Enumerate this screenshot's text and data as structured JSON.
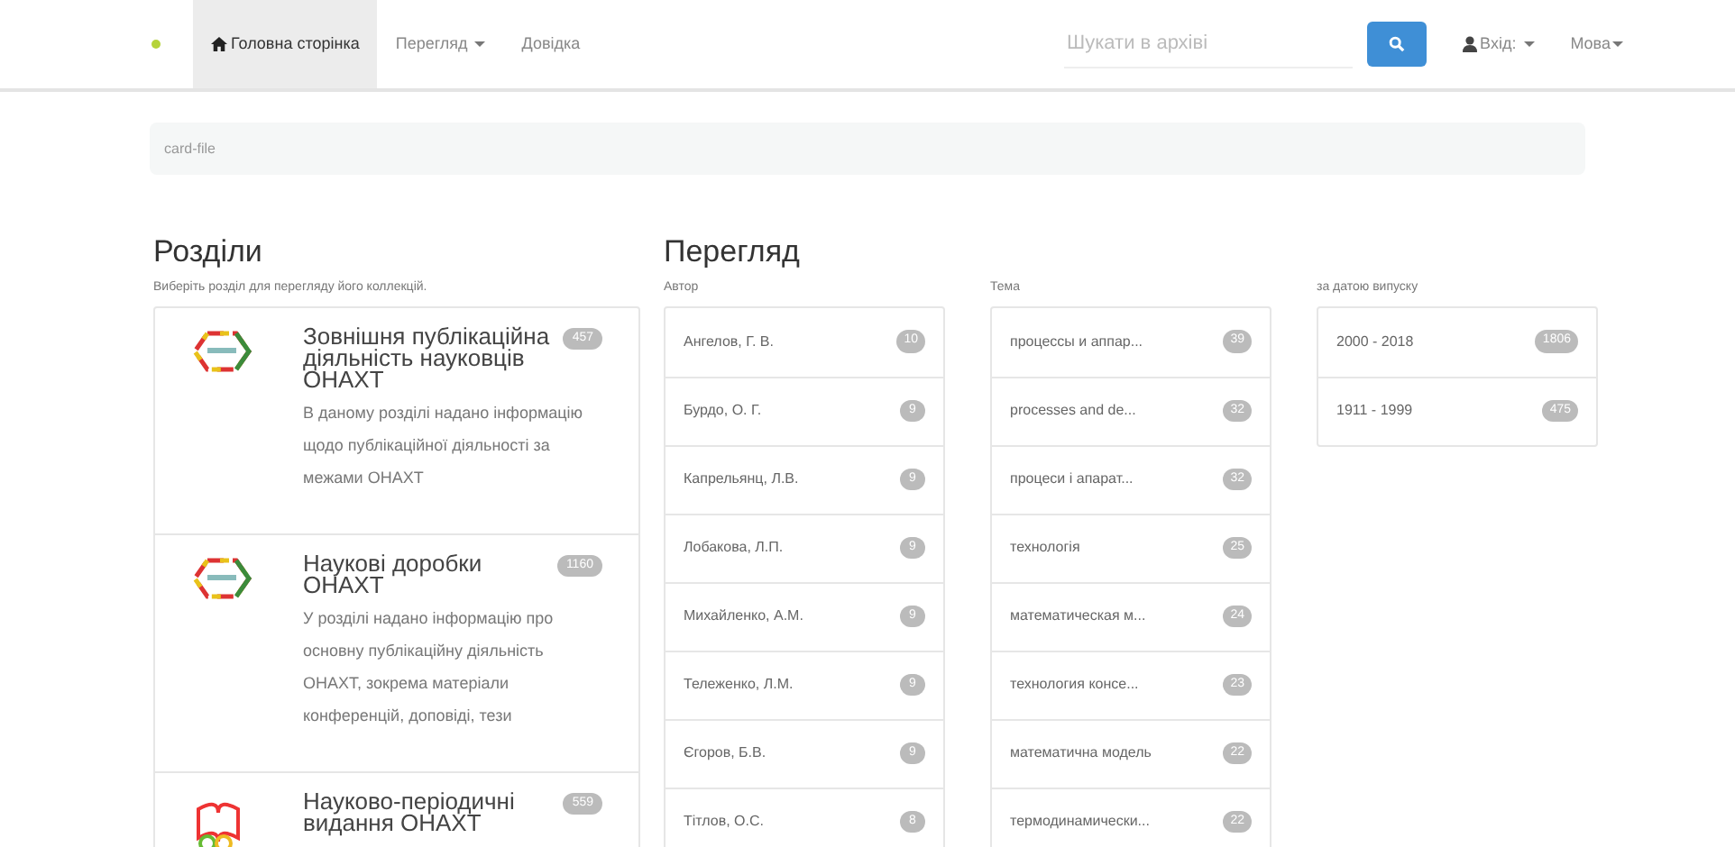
{
  "navbar": {
    "items": [
      {
        "label": "Головна сторінка",
        "selected": true,
        "dropdown": false,
        "kind": "home"
      },
      {
        "label": "Перегляд",
        "selected": false,
        "dropdown": true,
        "kind": "plain"
      },
      {
        "label": "Довідка",
        "selected": false,
        "dropdown": false,
        "kind": "plain"
      }
    ],
    "search": {
      "placeholder": "Шукати в архіві"
    },
    "login": {
      "label": "Вхід:"
    },
    "language": {
      "label": "Мова"
    }
  },
  "breadcrumb": "card-file",
  "sections": {
    "title": "Розділи",
    "hint": "Виберіть розділ для перегляду його коллекцій.",
    "items": [
      {
        "kind": "chain",
        "title": "Зовнішня публікаційна діяльність науковців ОНАХТ",
        "count": "457",
        "description": "В даному розділі надано інформацію щодо публікаційної діяльності за межами ОНАХТ"
      },
      {
        "kind": "chain",
        "title": "Наукові доробки ОНАХТ",
        "count": "1160",
        "description": "У розділі надано інформацію про основну публікаційну діяльність ОНАХТ, зокрема матеріали конференцій, доповіді, тези"
      },
      {
        "kind": "book",
        "title": "Науково-періодичні видання ОНАХТ",
        "count": "559"
      }
    ]
  },
  "browse": {
    "title": "Перегляд",
    "lists": [
      {
        "heading": "Автор",
        "items": [
          {
            "label": "Ангелов, Г. В.",
            "count": "10"
          },
          {
            "label": "Бурдо, О. Г.",
            "count": "9"
          },
          {
            "label": "Капрельянц, Л.В.",
            "count": "9"
          },
          {
            "label": "Лобакова, Л.П.",
            "count": "9"
          },
          {
            "label": "Михайленко, А.М.",
            "count": "9"
          },
          {
            "label": "Тележенко, Л.М.",
            "count": "9"
          },
          {
            "label": "Єгоров, Б.В.",
            "count": "9"
          },
          {
            "label": "Тітлов, О.С.",
            "count": "8"
          }
        ]
      },
      {
        "heading": "Тема",
        "items": [
          {
            "label": "процессы и аппар...",
            "count": "39"
          },
          {
            "label": "processes and de...",
            "count": "32"
          },
          {
            "label": "процеси і апарат...",
            "count": "32"
          },
          {
            "label": "технологія",
            "count": "25"
          },
          {
            "label": "математическая м...",
            "count": "24"
          },
          {
            "label": "технология консе...",
            "count": "23"
          },
          {
            "label": "математична модель",
            "count": "22"
          },
          {
            "label": "термодинамически...",
            "count": "22"
          }
        ]
      },
      {
        "heading": "за датою випуску",
        "items": [
          {
            "label": "2000 - 2018",
            "count": "1806"
          },
          {
            "label": "1911 - 1999",
            "count": "475"
          }
        ]
      }
    ]
  }
}
